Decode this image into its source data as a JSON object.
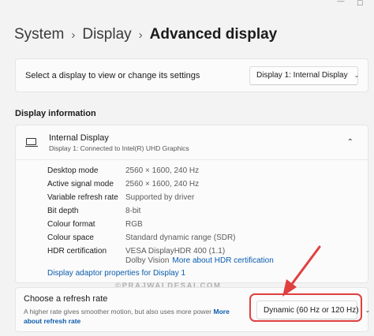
{
  "window": {
    "minimize_glyph": "—",
    "maximize_glyph": "☐"
  },
  "breadcrumb": {
    "items": [
      "System",
      "Display"
    ],
    "current": "Advanced display",
    "separator": "›"
  },
  "display_select": {
    "label": "Select a display to view or change its settings",
    "value": "Display 1: Internal Display"
  },
  "display_information": {
    "section_title": "Display information",
    "display_name": "Internal Display",
    "display_subtitle": "Display 1: Connected to Intel(R) UHD Graphics",
    "rows": [
      {
        "label": "Desktop mode",
        "value": "2560 × 1600, 240 Hz"
      },
      {
        "label": "Active signal mode",
        "value": "2560 × 1600, 240 Hz"
      },
      {
        "label": "Variable refresh rate",
        "value": "Supported by driver"
      },
      {
        "label": "Bit depth",
        "value": "8-bit"
      },
      {
        "label": "Colour format",
        "value": "RGB"
      },
      {
        "label": "Colour space",
        "value": "Standard dynamic range (SDR)"
      }
    ],
    "hdr": {
      "label": "HDR certification",
      "value_line1": "VESA DisplayHDR 400 (1.1)",
      "value_line2": "Dolby Vision",
      "link": "More about HDR certification"
    },
    "adapter_link": "Display adaptor properties for Display 1"
  },
  "refresh_rate": {
    "title": "Choose a refresh rate",
    "description": "A higher rate gives smoother motion, but also uses more power",
    "link": "More about refresh rate",
    "value": "Dynamic (60 Hz or 120 Hz)"
  },
  "watermark": "©PRAJWALDESAI.COM",
  "colors": {
    "accent_link": "#0b5cad",
    "highlight": "#e03f3f",
    "background": "#f3f3f3"
  },
  "icons": {
    "chevron_down": "⌄",
    "chevron_up": "⌃"
  }
}
